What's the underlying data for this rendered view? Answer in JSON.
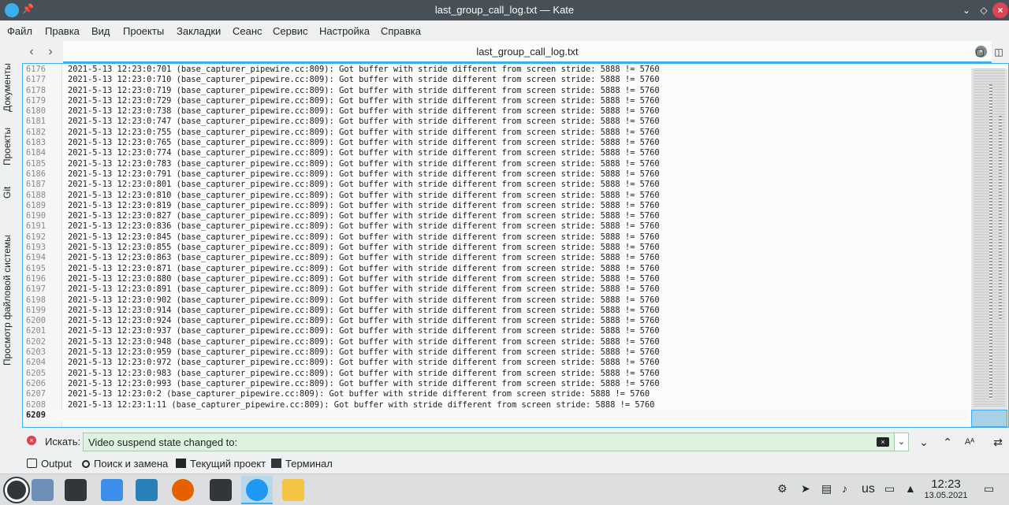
{
  "window": {
    "title": "last_group_call_log.txt — Kate",
    "pin_icon": "pin-icon",
    "buttons": [
      "minimize-icon",
      "maximize-icon",
      "close-icon"
    ]
  },
  "menu": [
    "Файл",
    "Правка",
    "Вид",
    "Проекты",
    "Закладки",
    "Сеанс",
    "Сервис",
    "Настройка",
    "Справка"
  ],
  "tabs": {
    "active": "last_group_call_log.txt"
  },
  "side_panels": {
    "documents": "Документы",
    "projects": "Проекты",
    "git": "Git",
    "filesystem": "Просмотр файловой системы"
  },
  "editor": {
    "lines": [
      {
        "n": "6176",
        "t": "2021-5-13 12:23:0:701 (base_capturer_pipewire.cc:809): Got buffer with stride different from screen stride: 5888 != 5760"
      },
      {
        "n": "6177",
        "t": "2021-5-13 12:23:0:710 (base_capturer_pipewire.cc:809): Got buffer with stride different from screen stride: 5888 != 5760"
      },
      {
        "n": "6178",
        "t": "2021-5-13 12:23:0:719 (base_capturer_pipewire.cc:809): Got buffer with stride different from screen stride: 5888 != 5760"
      },
      {
        "n": "6179",
        "t": "2021-5-13 12:23:0:729 (base_capturer_pipewire.cc:809): Got buffer with stride different from screen stride: 5888 != 5760"
      },
      {
        "n": "6180",
        "t": "2021-5-13 12:23:0:738 (base_capturer_pipewire.cc:809): Got buffer with stride different from screen stride: 5888 != 5760"
      },
      {
        "n": "6181",
        "t": "2021-5-13 12:23:0:747 (base_capturer_pipewire.cc:809): Got buffer with stride different from screen stride: 5888 != 5760"
      },
      {
        "n": "6182",
        "t": "2021-5-13 12:23:0:755 (base_capturer_pipewire.cc:809): Got buffer with stride different from screen stride: 5888 != 5760"
      },
      {
        "n": "6183",
        "t": "2021-5-13 12:23:0:765 (base_capturer_pipewire.cc:809): Got buffer with stride different from screen stride: 5888 != 5760"
      },
      {
        "n": "6184",
        "t": "2021-5-13 12:23:0:774 (base_capturer_pipewire.cc:809): Got buffer with stride different from screen stride: 5888 != 5760"
      },
      {
        "n": "6185",
        "t": "2021-5-13 12:23:0:783 (base_capturer_pipewire.cc:809): Got buffer with stride different from screen stride: 5888 != 5760"
      },
      {
        "n": "6186",
        "t": "2021-5-13 12:23:0:791 (base_capturer_pipewire.cc:809): Got buffer with stride different from screen stride: 5888 != 5760"
      },
      {
        "n": "6187",
        "t": "2021-5-13 12:23:0:801 (base_capturer_pipewire.cc:809): Got buffer with stride different from screen stride: 5888 != 5760"
      },
      {
        "n": "6188",
        "t": "2021-5-13 12:23:0:810 (base_capturer_pipewire.cc:809): Got buffer with stride different from screen stride: 5888 != 5760"
      },
      {
        "n": "6189",
        "t": "2021-5-13 12:23:0:819 (base_capturer_pipewire.cc:809): Got buffer with stride different from screen stride: 5888 != 5760"
      },
      {
        "n": "6190",
        "t": "2021-5-13 12:23:0:827 (base_capturer_pipewire.cc:809): Got buffer with stride different from screen stride: 5888 != 5760"
      },
      {
        "n": "6191",
        "t": "2021-5-13 12:23:0:836 (base_capturer_pipewire.cc:809): Got buffer with stride different from screen stride: 5888 != 5760"
      },
      {
        "n": "6192",
        "t": "2021-5-13 12:23:0:845 (base_capturer_pipewire.cc:809): Got buffer with stride different from screen stride: 5888 != 5760"
      },
      {
        "n": "6193",
        "t": "2021-5-13 12:23:0:855 (base_capturer_pipewire.cc:809): Got buffer with stride different from screen stride: 5888 != 5760"
      },
      {
        "n": "6194",
        "t": "2021-5-13 12:23:0:863 (base_capturer_pipewire.cc:809): Got buffer with stride different from screen stride: 5888 != 5760"
      },
      {
        "n": "6195",
        "t": "2021-5-13 12:23:0:871 (base_capturer_pipewire.cc:809): Got buffer with stride different from screen stride: 5888 != 5760"
      },
      {
        "n": "6196",
        "t": "2021-5-13 12:23:0:880 (base_capturer_pipewire.cc:809): Got buffer with stride different from screen stride: 5888 != 5760"
      },
      {
        "n": "6197",
        "t": "2021-5-13 12:23:0:891 (base_capturer_pipewire.cc:809): Got buffer with stride different from screen stride: 5888 != 5760"
      },
      {
        "n": "6198",
        "t": "2021-5-13 12:23:0:902 (base_capturer_pipewire.cc:809): Got buffer with stride different from screen stride: 5888 != 5760"
      },
      {
        "n": "6199",
        "t": "2021-5-13 12:23:0:914 (base_capturer_pipewire.cc:809): Got buffer with stride different from screen stride: 5888 != 5760"
      },
      {
        "n": "6200",
        "t": "2021-5-13 12:23:0:924 (base_capturer_pipewire.cc:809): Got buffer with stride different from screen stride: 5888 != 5760"
      },
      {
        "n": "6201",
        "t": "2021-5-13 12:23:0:937 (base_capturer_pipewire.cc:809): Got buffer with stride different from screen stride: 5888 != 5760"
      },
      {
        "n": "6202",
        "t": "2021-5-13 12:23:0:948 (base_capturer_pipewire.cc:809): Got buffer with stride different from screen stride: 5888 != 5760"
      },
      {
        "n": "6203",
        "t": "2021-5-13 12:23:0:959 (base_capturer_pipewire.cc:809): Got buffer with stride different from screen stride: 5888 != 5760"
      },
      {
        "n": "6204",
        "t": "2021-5-13 12:23:0:972 (base_capturer_pipewire.cc:809): Got buffer with stride different from screen stride: 5888 != 5760"
      },
      {
        "n": "6205",
        "t": "2021-5-13 12:23:0:983 (base_capturer_pipewire.cc:809): Got buffer with stride different from screen stride: 5888 != 5760"
      },
      {
        "n": "6206",
        "t": "2021-5-13 12:23:0:993 (base_capturer_pipewire.cc:809): Got buffer with stride different from screen stride: 5888 != 5760"
      },
      {
        "n": "6207",
        "t": "2021-5-13 12:23:0:2 (base_capturer_pipewire.cc:809): Got buffer with stride different from screen stride: 5888 != 5760"
      },
      {
        "n": "6208",
        "t": "2021-5-13 12:23:1:11 (base_capturer_pipewire.cc:809): Got buffer with stride different from screen stride: 5888 != 5760"
      },
      {
        "n": "6209",
        "t": ""
      }
    ],
    "current_line": "6209"
  },
  "search": {
    "label": "Искать:",
    "value": "Video suspend state changed to:",
    "status_icon": "error-icon",
    "buttons": [
      "chevron-down-icon",
      "chevron-up-icon",
      "match-case-icon",
      "replace-toggle-icon"
    ]
  },
  "toolviews": [
    "Output",
    "Поиск и замена",
    "Текущий проект",
    "Терминал"
  ],
  "taskbar": {
    "tasks": [
      "desktop-pager",
      "settings-app",
      "discover-app",
      "dolphin-app",
      "firefox-app",
      "konsole-app",
      "kate-app",
      "office-app"
    ],
    "active_task": "kate-app",
    "tray": [
      "network-icon",
      "telegram-icon",
      "clipboard-icon",
      "volume-icon",
      "display-icon",
      "tray-expand-icon"
    ],
    "language": "us",
    "time": "12:23",
    "date": "13.05.2021"
  },
  "colors": {
    "accent": "#3daee9",
    "titlebar": "#475057",
    "search_bg": "#ddf3df",
    "close": "#da4453"
  }
}
